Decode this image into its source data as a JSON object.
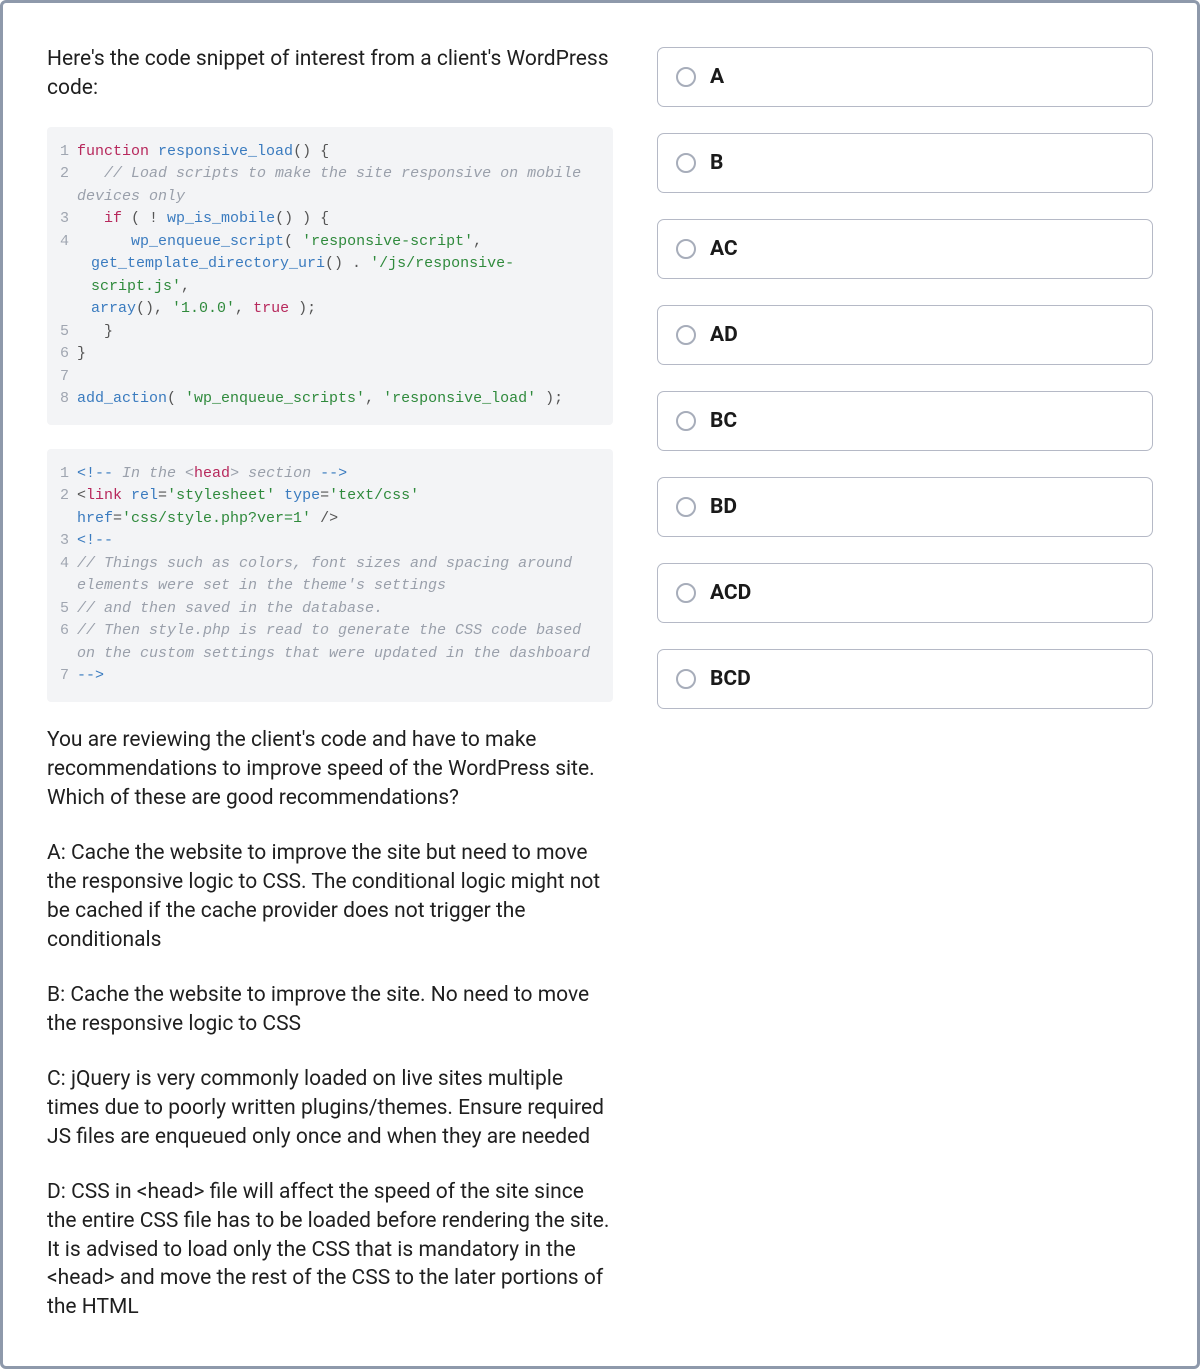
{
  "question": {
    "intro": "Here's the code snippet of interest from a client's WordPress code:",
    "followup": "You are reviewing the client's code and have to make recommendations to improve speed of the WordPress site. Which of these are good recommendations?",
    "choiceA": "A: Cache the website to improve the site but need to move the responsive logic to CSS. The conditional logic might not be cached if the cache provider does not trigger the conditionals",
    "choiceB": "B: Cache the website to improve the site. No need to move the responsive logic to CSS",
    "choiceC": "C: jQuery is very commonly loaded on live sites multiple times due to poorly written plugins/themes. Ensure required JS files are enqueued only once and when they are needed",
    "choiceD": "D: CSS in <head> file will affect the speed of the site since the entire CSS file has to be loaded before rendering the site. It is advised to load only the CSS that is mandatory in the <head> and move the rest of the CSS to the later portions of the HTML"
  },
  "code1": {
    "l1_kw_fn": "function",
    "l1_name": "responsive_load",
    "l1_rest": "() {",
    "l2_comment": "// Load scripts to make the site responsive on mobile devices only",
    "l3_if": "if",
    "l3_open": " ( ! ",
    "l3_fn": "wp_is_mobile",
    "l3_close": "() ) {",
    "l4_fn": "wp_enqueue_script",
    "l4_p1": "( ",
    "l4_s1": "'responsive-script'",
    "l4_c1": ", ",
    "l4b_fn": "get_template_directory_uri",
    "l4b_p": "() . ",
    "l4b_s": "'/js/responsive-script.js'",
    "l4b_c": ", ",
    "l4c_fn": "array",
    "l4c_p": "(), ",
    "l4c_s": "'1.0.0'",
    "l4c_c": ", ",
    "l4c_true": "true",
    "l4c_end": " );",
    "l5": "   }",
    "l6": "}",
    "l7": "",
    "l8_fn": "add_action",
    "l8_p1": "( ",
    "l8_s1": "'wp_enqueue_scripts'",
    "l8_c1": ", ",
    "l8_s2": "'responsive_load'",
    "l8_end": " );"
  },
  "code2": {
    "l1_open": "<!--",
    "l1_txt": " In the ",
    "l1_head_open": "<",
    "l1_head": "head",
    "l1_head_close": ">",
    "l1_txt2": " section ",
    "l1_close": "-->",
    "l2_open": "<",
    "l2_tag": "link",
    "l2_a1": " rel",
    "l2_e": "=",
    "l2_v1": "'stylesheet'",
    "l2_a2": " type",
    "l2_v2": "'text/css'",
    "l2_a3": " href",
    "l2_v3": "'css/style.php?ver=1'",
    "l2_close": " />",
    "l3": "<!--",
    "l4": "// Things such as colors, font sizes and spacing around elements were set in the theme's settings",
    "l5": "// and then saved in the database.",
    "l6": "// Then style.php is read to generate the CSS code based on the custom settings that were updated in the dashboard",
    "l7": "-->"
  },
  "options": [
    {
      "label": "A"
    },
    {
      "label": "B"
    },
    {
      "label": "AC"
    },
    {
      "label": "AD"
    },
    {
      "label": "BC"
    },
    {
      "label": "BD"
    },
    {
      "label": "ACD"
    },
    {
      "label": "BCD"
    }
  ]
}
